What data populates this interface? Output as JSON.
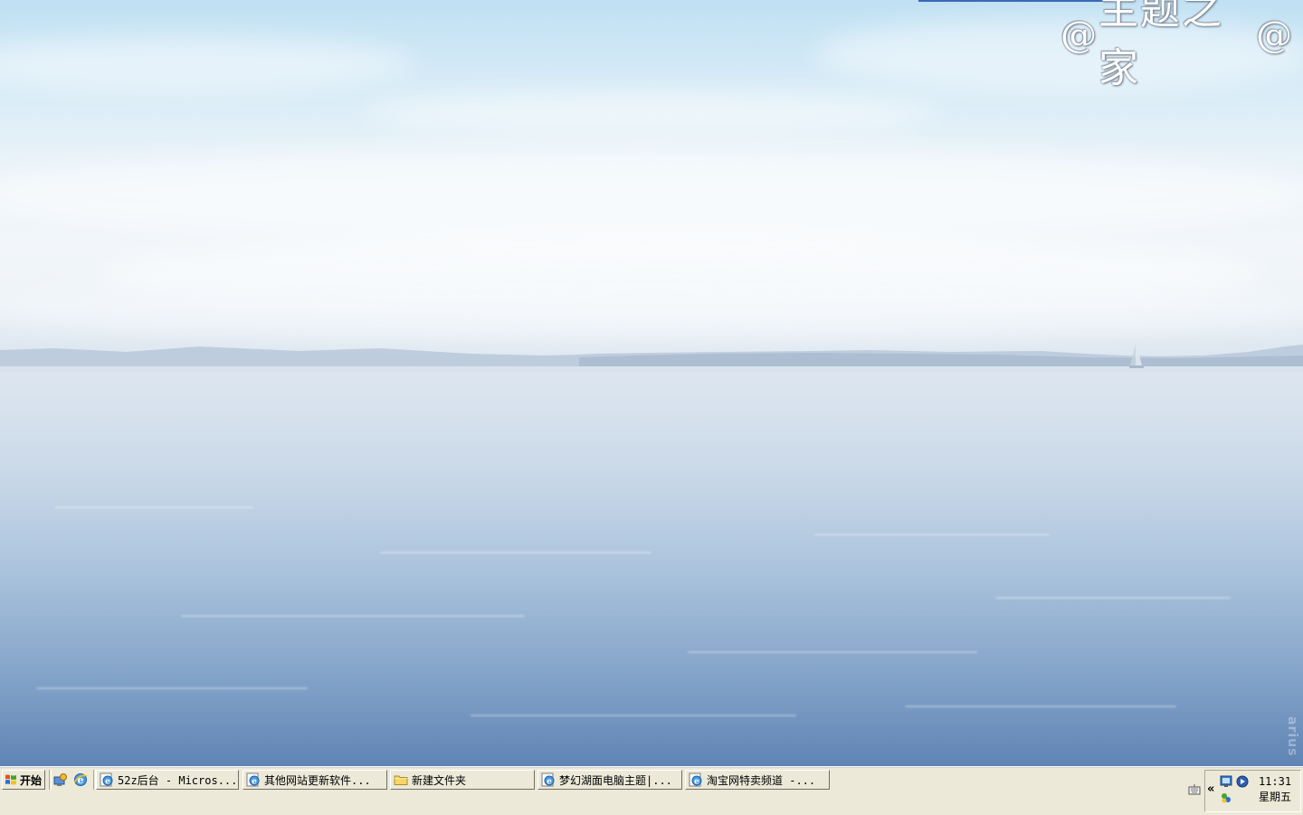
{
  "desktop": {
    "logo_text": "主题之家",
    "watermark": "arius"
  },
  "taskbar": {
    "start_label": "开始",
    "quick_launch": [
      {
        "icon": "show-desktop-icon"
      },
      {
        "icon": "internet-explorer-icon"
      }
    ],
    "tasks": [
      {
        "label": "52z后台 - Micros...",
        "icon": "ie-page-icon"
      },
      {
        "label": "其他网站更新软件...",
        "icon": "ie-page-icon"
      },
      {
        "label": "新建文件夹",
        "icon": "folder-icon"
      },
      {
        "label": "梦幻湖面电脑主题|...",
        "icon": "ie-page-icon"
      },
      {
        "label": "淘宝网特卖频道 -...",
        "icon": "ie-page-icon"
      }
    ],
    "tray": {
      "expand_arrow": "«",
      "time": "11:31",
      "day": "星期五"
    }
  }
}
